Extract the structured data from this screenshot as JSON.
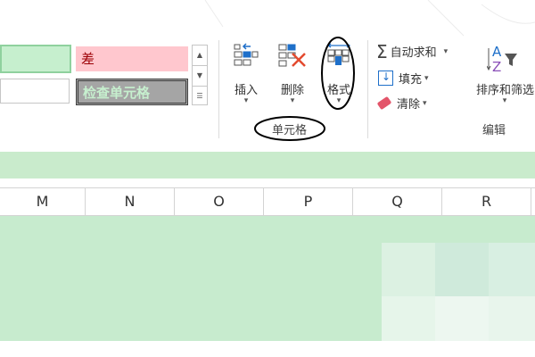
{
  "styles": {
    "neutral_good": "",
    "normal": "",
    "bad_label": "差",
    "check_cell_label": "检查单元格",
    "scroll_up": "▲",
    "scroll_down": "▼",
    "scroll_more": "☰"
  },
  "cells_group": {
    "label": "单元格",
    "insert": {
      "label": "插入",
      "icon": "insert-cells-icon"
    },
    "delete": {
      "label": "删除",
      "icon": "delete-cells-icon"
    },
    "format": {
      "label": "格式",
      "icon": "format-cells-icon"
    },
    "dropdown_arrow": "▾"
  },
  "editing_group": {
    "label": "编辑",
    "autosum": {
      "label": "自动求和",
      "icon": "autosum-sigma-icon"
    },
    "fill": {
      "label": "填充",
      "icon": "fill-down-icon"
    },
    "clear": {
      "label": "清除",
      "icon": "eraser-icon"
    },
    "sort_filter": {
      "label": "排序和筛选",
      "icon": "sort-filter-icon"
    },
    "dropdown_arrow": "▾"
  },
  "columns": [
    "M",
    "N",
    "O",
    "P",
    "Q",
    "R"
  ],
  "colors": {
    "good_fill": "#c6efce",
    "bad_fill": "#ffc7ce",
    "bad_text": "#9c0006",
    "check_fill": "#a5a5a5",
    "check_text": "#c6efce",
    "sheet_green": "#c7ebce",
    "annotation": "#000000"
  }
}
